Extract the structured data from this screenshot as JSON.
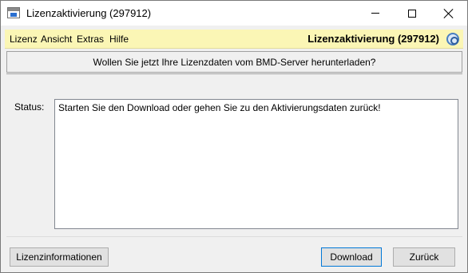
{
  "window": {
    "title": "Lizenzaktivierung (297912)",
    "controls": {
      "minimize": "minimize-icon",
      "maximize": "maximize-icon",
      "close": "close-icon"
    }
  },
  "menubar": {
    "items": [
      {
        "label": "Lizenz"
      },
      {
        "label": "Ansicht"
      },
      {
        "label": "Extras"
      },
      {
        "label": "Hilfe"
      }
    ],
    "title": "Lizenzaktivierung (297912)",
    "help_icon": "help-icon",
    "background": "#fbf6b5"
  },
  "question": "Wollen Sie jetzt Ihre Lizenzdaten vom BMD-Server herunterladen?",
  "status": {
    "label": "Status:",
    "text": "Starten Sie den Download oder gehen Sie zu den Aktivierungsdaten zurück!"
  },
  "buttons": {
    "info": "Lizenzinformationen",
    "download": "Download",
    "back": "Zurück"
  },
  "colors": {
    "focus_border": "#0078d7",
    "button_face": "#e1e1e1"
  }
}
